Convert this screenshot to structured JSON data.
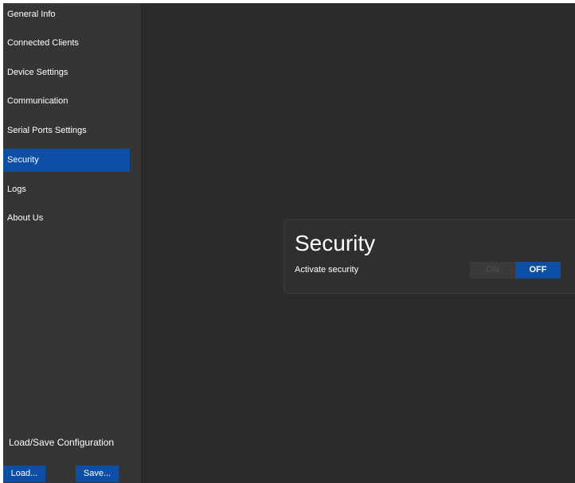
{
  "sidebar": {
    "items": [
      {
        "label": "General Info"
      },
      {
        "label": "Connected Clients"
      },
      {
        "label": "Device Settings"
      },
      {
        "label": "Communication"
      },
      {
        "label": "Serial Ports Settings"
      },
      {
        "label": "Security",
        "active": true
      },
      {
        "label": "Logs"
      },
      {
        "label": "About Us"
      }
    ],
    "config_title": "Load/Save Configuration",
    "load_label": "Load...",
    "save_label": "Save..."
  },
  "security_panel": {
    "title": "Security",
    "activate_label": "Activate security",
    "toggle": {
      "on_label": "ON",
      "off_label": "OFF",
      "selected": "OFF"
    }
  },
  "colors": {
    "accent": "#0e4fa5",
    "background": "#2b2b2b",
    "sidebar": "#353535"
  }
}
